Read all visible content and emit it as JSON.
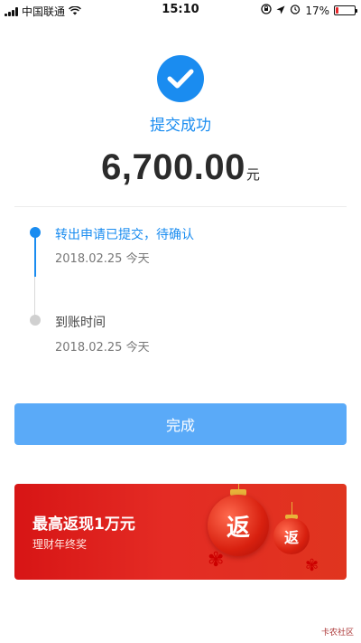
{
  "status_bar": {
    "carrier": "中国联通",
    "time": "15:10",
    "battery_text": "17%",
    "battery_level": 0.17,
    "icons": [
      "signal-icon",
      "wifi-icon",
      "orientation-lock-icon",
      "location-icon",
      "alarm-icon",
      "battery-icon"
    ]
  },
  "result": {
    "title": "提交成功",
    "amount": "6,700.00",
    "unit": "元",
    "icon": "check-circle-icon",
    "accent_color": "#1a8cf0"
  },
  "timeline": [
    {
      "label": "转出申请已提交，待确认",
      "time": "2018.02.25 今天",
      "state": "done"
    },
    {
      "label": "到账时间",
      "time": "2018.02.25 今天",
      "state": "pending"
    }
  ],
  "done_button": {
    "label": "完成",
    "color": "#5aaaf8"
  },
  "banner": {
    "title": "最高返现1万元",
    "subtitle": "理财年终奖",
    "lantern_char": "返",
    "color": "#d71515"
  },
  "watermark": {
    "text": "卡农社区"
  }
}
